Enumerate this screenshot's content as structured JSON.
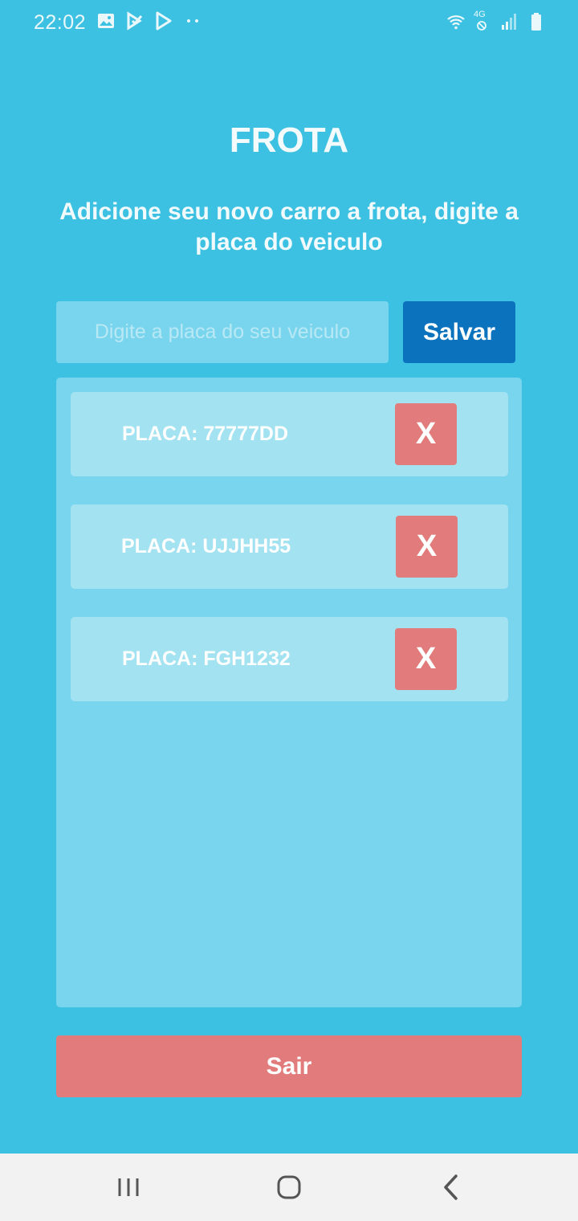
{
  "status_bar": {
    "time": "22:02",
    "network_label": "4G",
    "left_icons": [
      "gallery-icon",
      "check-app-icon",
      "play-store-icon",
      "more-dots-icon"
    ],
    "right_icons": [
      "wifi-icon",
      "network-4g-icon",
      "signal-icon",
      "battery-icon"
    ]
  },
  "header": {
    "title": "FROTA",
    "subtitle": "Adicione seu novo carro a frota, digite a placa do veiculo"
  },
  "form": {
    "plate_placeholder": "Digite a placa do seu veiculo",
    "plate_value": "",
    "save_label": "Salvar"
  },
  "plates": [
    {
      "label": "PLACA: 77777DD",
      "remove_label": "X"
    },
    {
      "label": "PLACA: UJJHH55",
      "remove_label": "X"
    },
    {
      "label": "PLACA: FGH1232",
      "remove_label": "X"
    }
  ],
  "footer": {
    "exit_label": "Sair"
  },
  "nav_bar": {
    "icons": [
      "recents-icon",
      "home-icon",
      "back-icon"
    ]
  },
  "colors": {
    "background": "#3dc1e2",
    "panel": "#79d5ed",
    "card": "#a3e2f1",
    "save_button": "#0b73bd",
    "danger_button": "#e27b7b"
  }
}
